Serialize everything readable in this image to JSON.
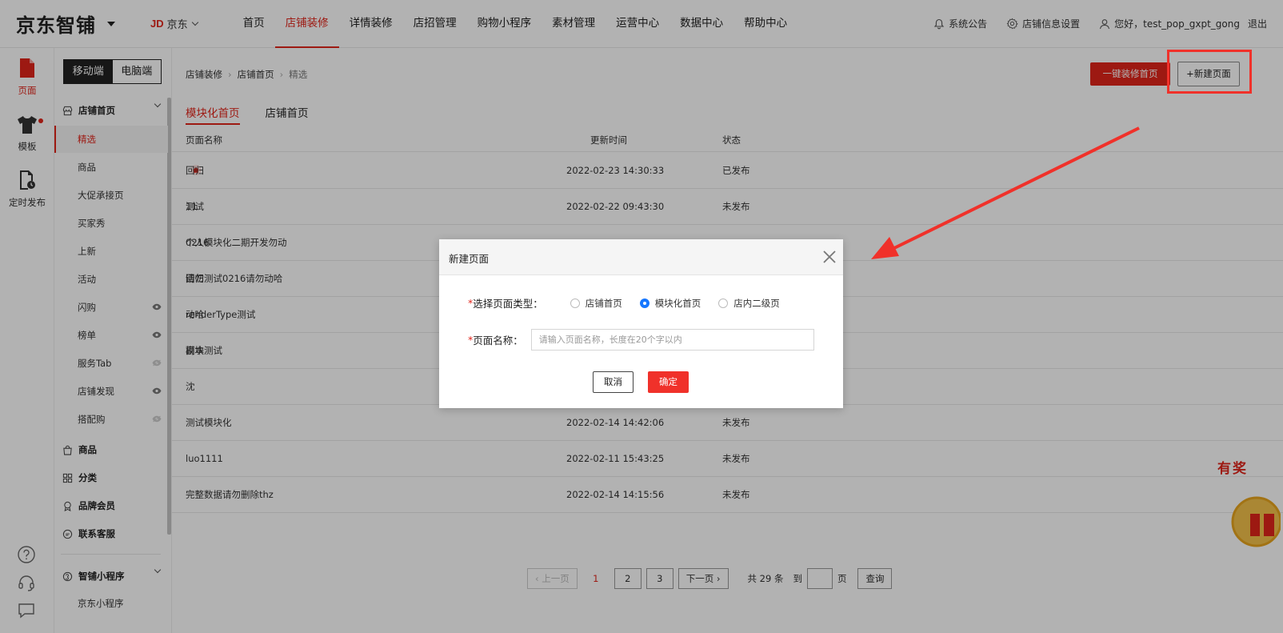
{
  "header": {
    "logo": "京东智铺",
    "store_mark": "JD",
    "store_name": "京东",
    "nav": [
      "首页",
      "店铺装修",
      "详情装修",
      "店招管理",
      "购物小程序",
      "素材管理",
      "运营中心",
      "数据中心",
      "帮助中心"
    ],
    "active_nav": "店铺装修",
    "announce": "系统公告",
    "settings": "店铺信息设置",
    "greeting": "您好，test_pop_gxpt_gong",
    "logout": "退出"
  },
  "rail": {
    "items": [
      {
        "label": "页面",
        "icon": "page-icon"
      },
      {
        "label": "模板",
        "icon": "tshirt-icon"
      },
      {
        "label": "定时发布",
        "icon": "schedule-doc-icon"
      }
    ],
    "bottom_icons": [
      "help-icon",
      "headset-icon",
      "feedback-icon"
    ]
  },
  "sidebar": {
    "toggle": {
      "mobile": "移动端",
      "pc": "电脑端"
    },
    "group_store_home": "店铺首页",
    "items": [
      "精选",
      "商品",
      "大促承接页",
      "买家秀",
      "上新",
      "活动",
      "闪购",
      "榜单",
      "服务Tab",
      "店铺发现",
      "搭配购"
    ],
    "groups": [
      "商品",
      "分类",
      "品牌会员",
      "联系客服"
    ],
    "group_mini": "智铺小程序",
    "mini_items": [
      "京东小程序"
    ]
  },
  "breadcrumb": {
    "a": "店铺装修",
    "b": "店铺首页",
    "c": "精选"
  },
  "actions": {
    "one_click": "一键装修首页",
    "new_page": "+新建页面"
  },
  "tabs": [
    "模块化首页",
    "店铺首页"
  ],
  "table": {
    "headers": {
      "name": "页面名称",
      "time": "更新时间",
      "status": "状态"
    },
    "rows": [
      {
        "name": "回归测试0216请勿动哈副本",
        "time": "2022-02-23 14:30:33",
        "status": "已发布"
      },
      {
        "name": "11",
        "time": "2022-02-22 09:43:30",
        "status": "未发布"
      },
      {
        "name": "个人模块化二期开发勿动",
        "time": "",
        "status": ""
      },
      {
        "name": "回归测试0216请勿动哈",
        "time": "",
        "status": ""
      },
      {
        "name": "renderType测试",
        "time": "",
        "status": ""
      },
      {
        "name": "模块测试",
        "time": "",
        "status": ""
      },
      {
        "name": "沈",
        "time": "",
        "status": ""
      },
      {
        "name": "测试模块化",
        "time": "2022-02-14 14:42:06",
        "status": "未发布"
      },
      {
        "name": "luo1111",
        "time": "2022-02-11 15:43:25",
        "status": "未发布"
      },
      {
        "name": "完整数据请勿删除thz",
        "time": "2022-02-14 14:15:56",
        "status": "未发布"
      }
    ]
  },
  "pagination": {
    "prev": "上一页",
    "current": "1",
    "pages": [
      "2",
      "3"
    ],
    "next": "下一页",
    "total": "共 29 条",
    "goto_prefix": "到",
    "goto_suffix": "页",
    "query": "查询"
  },
  "promo_text": "有奖",
  "modal": {
    "title": "新建页面",
    "type_label": "选择页面类型：",
    "types": [
      "店铺首页",
      "模块化首页",
      "店内二级页"
    ],
    "selected_type": "模块化首页",
    "name_label": "页面名称：",
    "name_placeholder": "请输入页面名称，长度在20个字以内",
    "name_value": "",
    "required_mark": "*",
    "cancel": "取消",
    "confirm": "确定"
  },
  "colors": {
    "brand_red": "#e1251b",
    "highlight_red": "#f0312a",
    "radio_blue": "#1677ff"
  }
}
